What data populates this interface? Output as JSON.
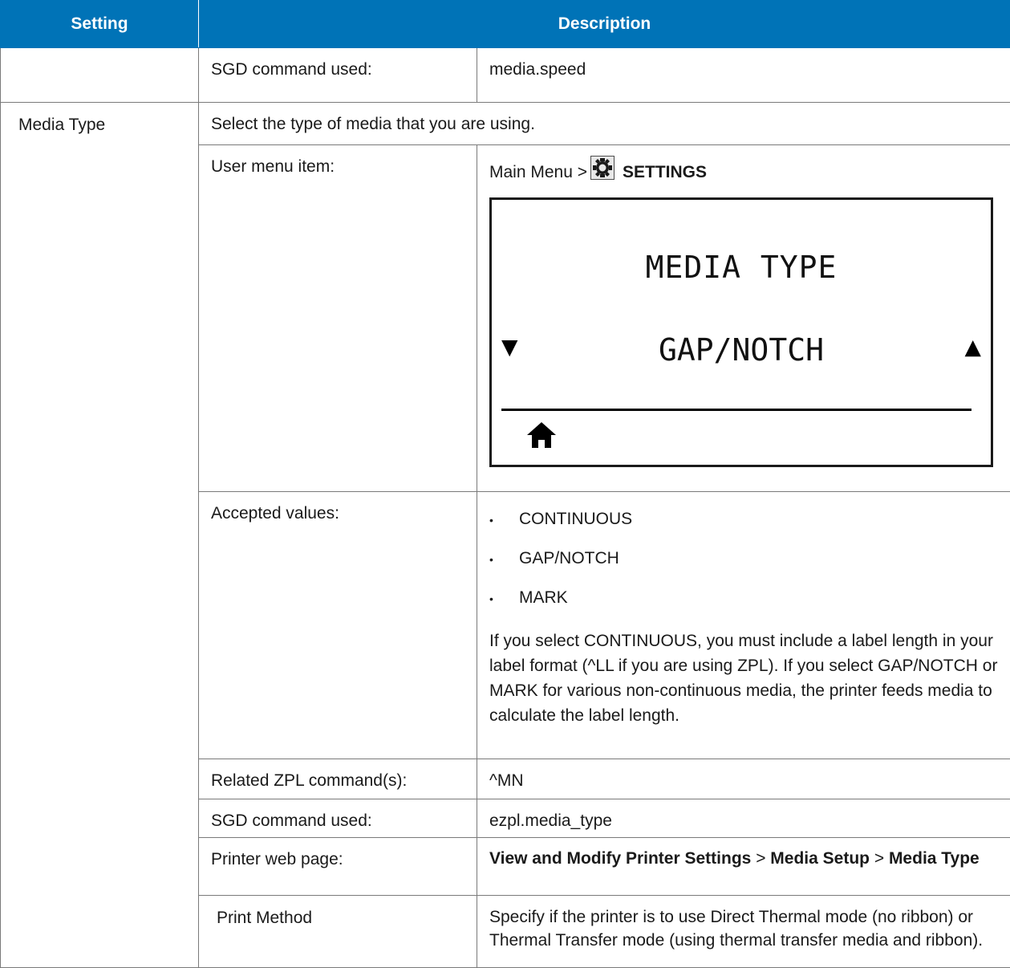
{
  "header": {
    "setting": "Setting",
    "description": "Description"
  },
  "row_speed": {
    "sgd_label": "SGD command used:",
    "sgd_value": "media.speed"
  },
  "media_type": {
    "name": "Media Type",
    "intro": "Select the type of media that you are using.",
    "menu_label": "User menu item:",
    "menu_crumb": "Main Menu >",
    "menu_section": "SETTINGS",
    "lcd": {
      "title": "MEDIA TYPE",
      "value": "GAP/NOTCH"
    },
    "accepted_label": "Accepted values:",
    "accepted_values": [
      "CONTINUOUS",
      "GAP/NOTCH",
      "MARK"
    ],
    "accepted_note": "If you select CONTINUOUS, you must include a label length in your label format (^LL if you are using ZPL). If you select GAP/NOTCH or MARK for various non-continuous media, the printer feeds media to calculate the label length.",
    "zpl_label": "Related ZPL command(s):",
    "zpl_value": "^MN",
    "sgd_label": "SGD command used:",
    "sgd_value": "ezpl.media_type",
    "web_label": "Printer web page:",
    "web_path_1": "View and Modify Printer Settings",
    "web_sep_1": ">",
    "web_path_2": "Media Setup",
    "web_sep_2": ">",
    "web_path_3": "Media Type"
  },
  "print_method": {
    "name": "Print Method",
    "intro": "Specify if the printer is to use Direct Thermal mode (no ribbon) or Thermal Transfer mode (using thermal transfer media and ribbon)."
  },
  "icons": {
    "gear": "gear-icon",
    "home": "home-icon",
    "arrow_down": "down-arrow-icon",
    "arrow_up": "up-arrow-icon"
  },
  "colors": {
    "header_bg": "#0073b7",
    "header_text": "#ffffff"
  }
}
